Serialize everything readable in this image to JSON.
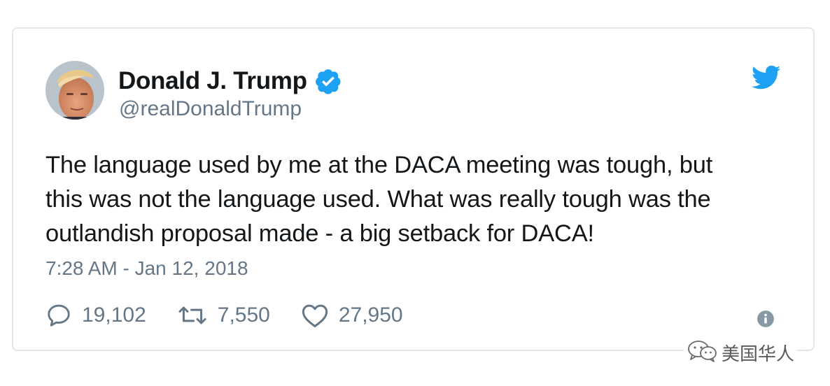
{
  "author": {
    "name": "Donald J. Trump",
    "handle": "@realDonaldTrump",
    "verified": true
  },
  "tweet": {
    "text_lines": [
      "The language used by me at the DACA meeting was tough, but",
      "this was not the language used. What was really tough was the",
      "outlandish proposal made - a big setback for DACA!"
    ],
    "timestamp": "7:28 AM - Jan 12, 2018"
  },
  "actions": {
    "replies": "19,102",
    "retweets": "7,550",
    "likes": "27,950"
  },
  "icons": {
    "brand": "twitter-bird-icon",
    "verified": "verified-badge-icon",
    "reply": "reply-icon",
    "retweet": "retweet-icon",
    "like": "heart-icon",
    "info": "info-icon"
  },
  "watermark": {
    "text": "美国华人"
  },
  "colors": {
    "twitter_blue": "#1da1f2",
    "text_primary": "#14171a",
    "text_secondary": "#657786",
    "border": "#e1e8ed"
  }
}
